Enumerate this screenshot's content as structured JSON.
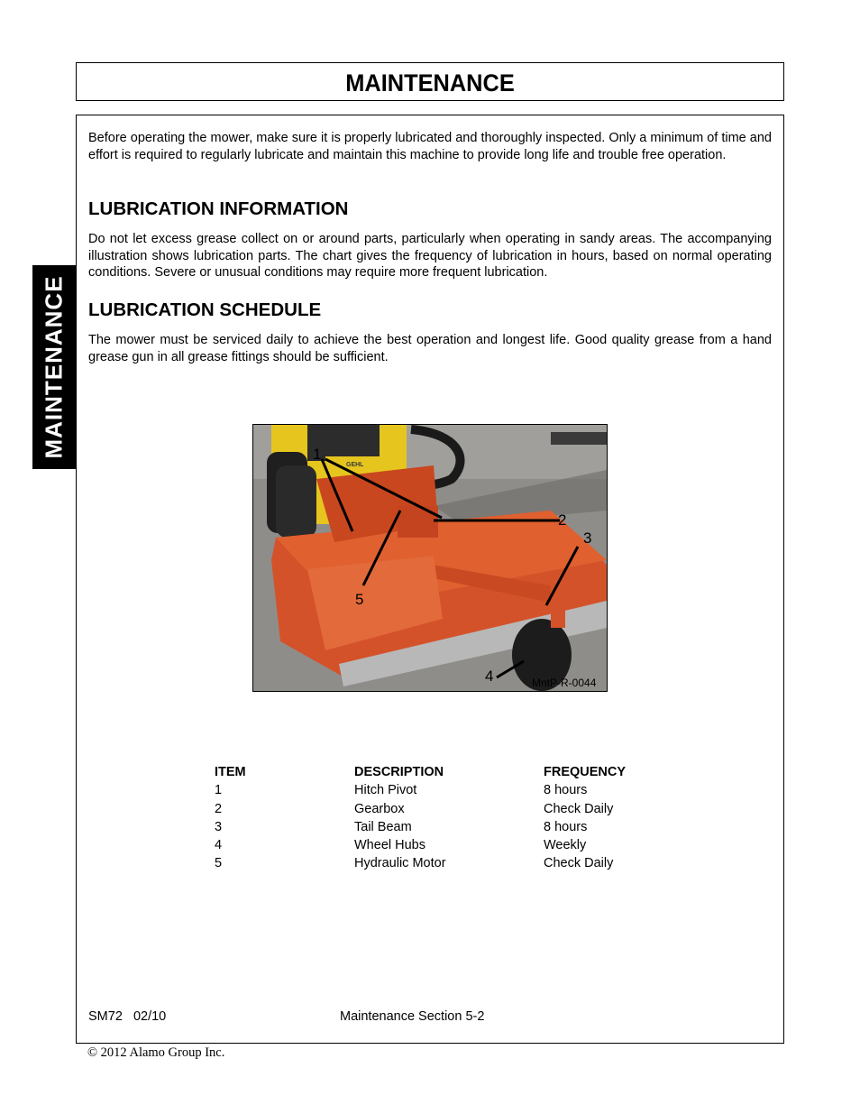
{
  "header": {
    "title": "MAINTENANCE"
  },
  "side_tab": {
    "label": "MAINTENANCE"
  },
  "intro": {
    "text": "Before operating the mower, make sure it is properly lubricated and thoroughly inspected. Only a minimum of time and effort is required to regularly lubricate and maintain this machine to provide long life and trouble free operation."
  },
  "lubrication_information": {
    "heading": "LUBRICATION INFORMATION",
    "text": "Do not let excess grease collect on or around parts, particularly when operating in sandy areas.  The accompanying illustration shows lubrication parts.  The chart gives the frequency of lubrication in hours, based on normal operating conditions. Severe or unusual conditions may require more frequent lubrication."
  },
  "lubrication_schedule": {
    "heading": "LUBRICATION SCHEDULE",
    "text": "The mower  must be serviced daily to achieve the best operation and longest life. Good quality grease from a hand grease gun in all grease fittings should be sufficient."
  },
  "figure": {
    "caption_id": "MntP-R-0044",
    "brand_decal": "GEHL",
    "callouts": [
      "1",
      "2",
      "3",
      "4",
      "5"
    ],
    "colors": {
      "mower": "#d8552a",
      "loader": "#e8c81e",
      "pavement": "#8e8c88"
    }
  },
  "schedule_table": {
    "headers": {
      "item": "ITEM",
      "description": "DESCRIPTION",
      "frequency": "FREQUENCY"
    },
    "rows": [
      {
        "item": "1",
        "description": "Hitch Pivot",
        "frequency": "8 hours"
      },
      {
        "item": "2",
        "description": "Gearbox",
        "frequency": "Check Daily"
      },
      {
        "item": "3",
        "description": "Tail Beam",
        "frequency": "8 hours"
      },
      {
        "item": "4",
        "description": "Wheel Hubs",
        "frequency": "Weekly"
      },
      {
        "item": "5",
        "description": "Hydraulic Motor",
        "frequency": "Check Daily"
      }
    ]
  },
  "footer": {
    "doc_id": "SM72   02/10",
    "section": "Maintenance Section 5-2",
    "copyright": "© 2012 Alamo Group Inc."
  }
}
